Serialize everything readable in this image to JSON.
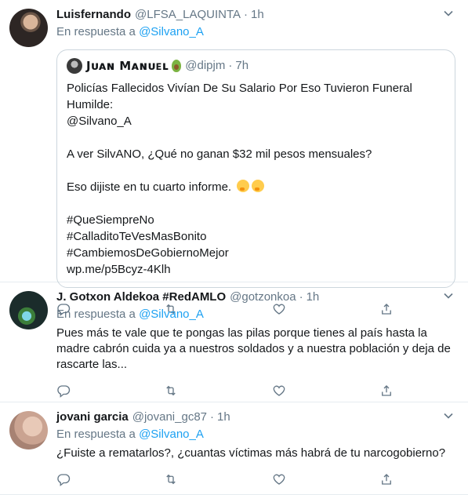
{
  "tweets": [
    {
      "name": "Luisfernando",
      "handle": "@LFSA_LAQUINTA",
      "time": "1h",
      "reply_prefix": "En respuesta a ",
      "reply_user": "@Silvano_A",
      "quote": {
        "name": "Jᴜᴀɴ Mᴀɴᴜᴇʟ",
        "handle": "@dipjm",
        "time": "7h",
        "text": "Policías Fallecidos Vivían De Su Salario Por Eso Tuvieron Funeral Humilde:\n@Silvano_A\n\nA ver SilvANO, ¿Qué no ganan $32 mil pesos mensuales?\n\nEso dijiste en tu cuarto informe.",
        "text_after_emoji": "#QueSiempreNo\n#CalladitoTeVesMasBonito\n#CambiemosDeGobiernoMejor\nwp.me/p5Bcyz-4Klh",
        "emojis": [
          "thinking-face-icon",
          "thinking-face-icon"
        ]
      }
    },
    {
      "name": "J. Gotxon Aldekoa #RedAMLO",
      "handle": "@gotzonkoa",
      "time": "1h",
      "reply_prefix": "En respuesta a ",
      "reply_user": "@Silvano_A",
      "text": "Pues más te vale que te pongas las pilas porque tienes al país hasta la madre cabrón cuida ya a nuestros soldados y a nuestra población y deja de rascarte las..."
    },
    {
      "name": "jovani garcia",
      "handle": "@jovani_gc87",
      "time": "1h",
      "reply_prefix": "En respuesta a ",
      "reply_user": "@Silvano_A",
      "text": "¿Fuiste a rematarlos?, ¿cuantas víctimas más habrá de tu narcogobierno?"
    }
  ],
  "dot": "·",
  "icons": {
    "reply": "reply-icon",
    "retweet": "retweet-icon",
    "like": "heart-icon",
    "share": "share-icon",
    "menu": "chevron-down-icon"
  },
  "colors": {
    "link": "#1da1f2",
    "muted": "#657786",
    "border": "#e6ecf0"
  }
}
